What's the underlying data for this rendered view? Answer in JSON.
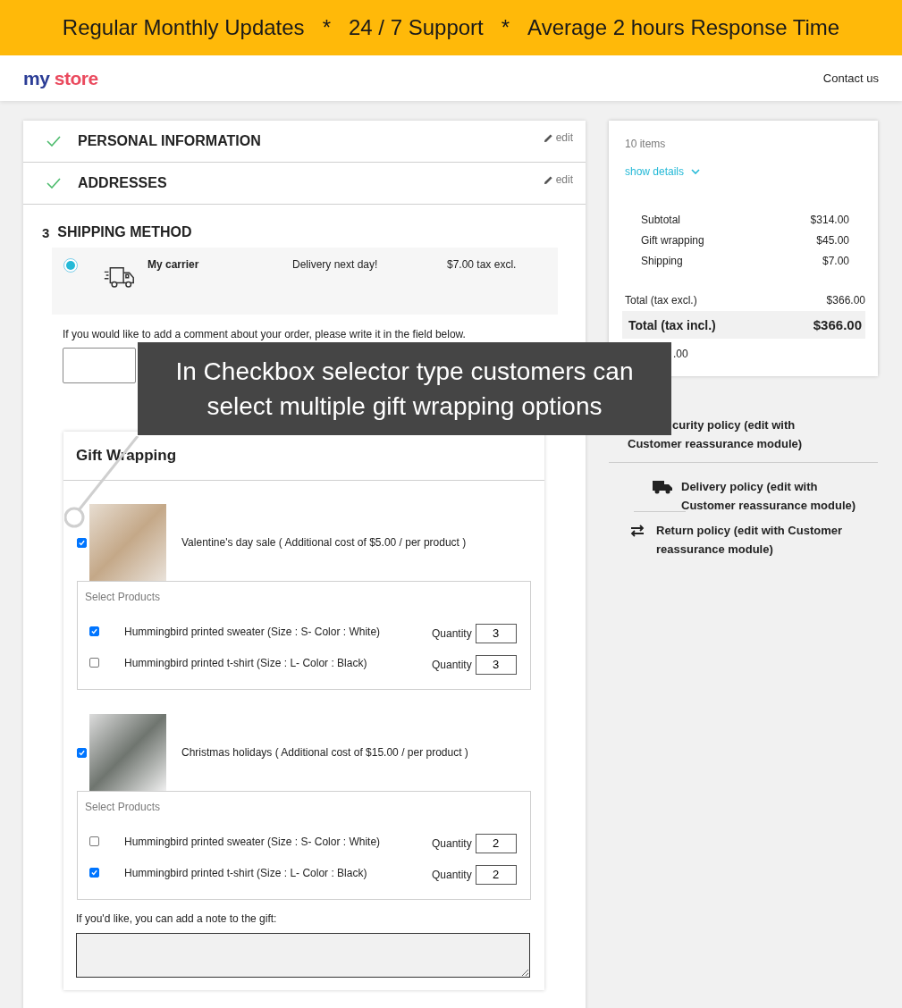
{
  "banner": {
    "items": [
      "Regular Monthly Updates",
      "*",
      "24 / 7 Support",
      "*",
      "Average 2 hours Response Time"
    ]
  },
  "header": {
    "logo": {
      "part_1": "my",
      "part_2": "store"
    },
    "contact_link": "Contact us"
  },
  "checkout": {
    "steps": [
      {
        "kind": "done",
        "title": "PERSONAL INFORMATION",
        "edit": "edit"
      },
      {
        "kind": "done",
        "title": "ADDRESSES",
        "edit": "edit"
      }
    ],
    "shipping": {
      "number": "3",
      "title": "SHIPPING METHOD",
      "carriers": [
        {
          "selected": true,
          "name": "My carrier",
          "delay": "Delivery next day!",
          "price": "$7.00 tax excl."
        }
      ],
      "comment_label": "If you would like to add a comment about your order, please write it in the field below."
    },
    "gift_wrapping": {
      "title": "Gift Wrapping",
      "options": [
        {
          "checked": true,
          "label": "Valentine's day sale ( Additional cost of $5.00 / per product )",
          "products_title": "Select Products",
          "products": [
            {
              "checked": true,
              "name": "Hummingbird printed sweater (Size : S- Color : White)",
              "quantity_label": "Quantity",
              "quantity": "3"
            },
            {
              "checked": false,
              "name": "Hummingbird printed t-shirt (Size : L- Color : Black)",
              "quantity_label": "Quantity",
              "quantity": "3"
            }
          ]
        },
        {
          "checked": true,
          "label": "Christmas holidays ( Additional cost of $15.00 / per product )",
          "products_title": "Select Products",
          "products": [
            {
              "checked": false,
              "name": "Hummingbird printed sweater (Size : S- Color : White)",
              "quantity_label": "Quantity",
              "quantity": "2"
            },
            {
              "checked": true,
              "name": "Hummingbird printed t-shirt (Size : L- Color : Black)",
              "quantity_label": "Quantity",
              "quantity": "2"
            }
          ]
        }
      ],
      "note_label": "If you'd like, you can add a note to the gift:"
    }
  },
  "summary": {
    "items_count": "10 items",
    "details_link": "show details",
    "lines": [
      {
        "label": "Subtotal",
        "value": "$314.00"
      },
      {
        "label": "Gift wrapping",
        "value": "$45.00"
      },
      {
        "label": "Shipping",
        "value": "$7.00"
      }
    ],
    "total_excl": {
      "label": "Total (tax excl.)",
      "value": "$366.00"
    },
    "total_incl": {
      "label": "Total (tax incl.)",
      "value": "$366.00"
    },
    "taxes_fragment": ".00"
  },
  "reassurance": [
    {
      "kind": "covered",
      "lines": [
        "curity policy (edit with",
        "Customer reassurance module)"
      ]
    },
    {
      "kind": "truck",
      "lines": [
        "Delivery policy (edit with",
        "Customer reassurance module)"
      ]
    },
    {
      "kind": "arrows",
      "lines": [
        "Return policy (edit with Customer",
        "reassurance module)"
      ]
    }
  ],
  "callout": {
    "text": "In Checkbox selector type customers can select multiple gift wrapping options"
  }
}
